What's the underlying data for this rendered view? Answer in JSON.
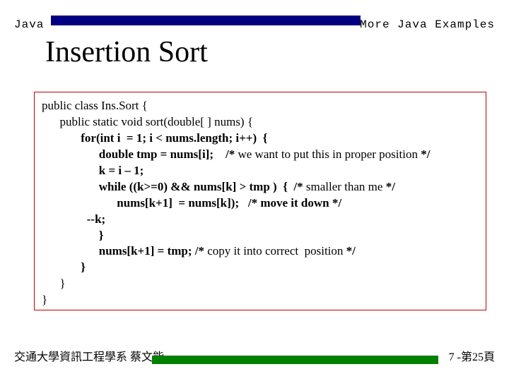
{
  "header": {
    "left": "Java",
    "right": "More Java Examples"
  },
  "title": "Insertion Sort",
  "code": {
    "l1": "public class Ins.Sort {",
    "l2": "      public static void sort(double[ ] nums) {",
    "l3a": "             for(int i  = 1; i < nums.length; i++)  {",
    "l4a": "                   double tmp = nums[i];    /* ",
    "l4b": "we want to put this in proper position ",
    "l4c": "*/",
    "l5": "                   k = i – 1;",
    "l6a": "                   while ((k>=0) && nums[k] > tmp )  {  /* ",
    "l6b": "smaller than me ",
    "l6c": "*/",
    "l7": "                         nums[k+1]  = nums[k]);   /* move it down */",
    "l8": "               --k;",
    "l9": "                   }",
    "l10a": "                   nums[k+1] = tmp; /* ",
    "l10b": "copy it into correct  position ",
    "l10c": "*/",
    "l11": "             }",
    "l12": "      }",
    "l13": "}"
  },
  "footer": {
    "left": "交通大學資訊工程學系 蔡文能",
    "right": "7 -第25頁"
  }
}
